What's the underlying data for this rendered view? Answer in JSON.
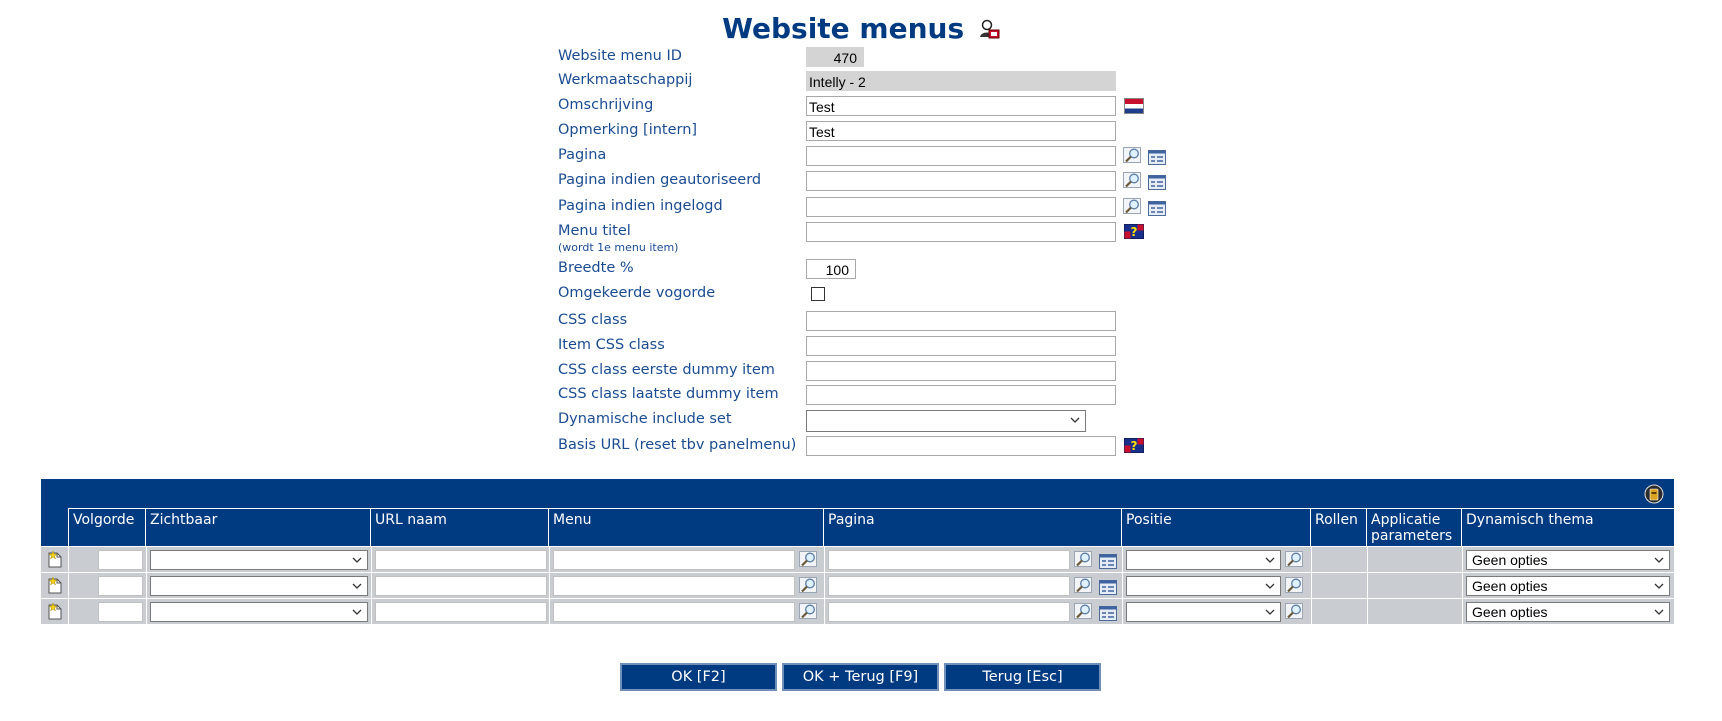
{
  "page": {
    "title": "Website menus"
  },
  "form": {
    "fields": [
      {
        "label": "Website menu ID",
        "value": "470"
      },
      {
        "label": "Werkmaatschappij",
        "value": "Intelly  -  2"
      },
      {
        "label": "Omschrijving",
        "value": "Test"
      },
      {
        "label": "Opmerking [intern]",
        "value": "Test"
      },
      {
        "label": "Pagina",
        "value": ""
      },
      {
        "label": "Pagina indien geautoriseerd",
        "value": ""
      },
      {
        "label": "Pagina indien ingelogd",
        "value": ""
      },
      {
        "label": "Menu titel",
        "sublabel": "(wordt 1e menu item)",
        "value": ""
      },
      {
        "label": "Breedte %",
        "value": "100"
      },
      {
        "label": "Omgekeerde vogorde",
        "checked": false
      },
      {
        "label": "CSS class",
        "value": ""
      },
      {
        "label": "Item CSS class",
        "value": ""
      },
      {
        "label": "CSS class eerste dummy item",
        "value": ""
      },
      {
        "label": "CSS class laatste dummy item",
        "value": ""
      },
      {
        "label": "Dynamische include set",
        "value": ""
      },
      {
        "label": "Basis URL (reset tbv panelmenu)",
        "value": ""
      }
    ]
  },
  "grid": {
    "columns": [
      "Volgorde",
      "Zichtbaar",
      "URL naam",
      "Menu",
      "Pagina",
      "Positie",
      "Rollen",
      "Applicatie parameters",
      "Dynamisch thema"
    ],
    "rows": [
      {
        "thema": "Geen opties"
      },
      {
        "thema": "Geen opties"
      },
      {
        "thema": "Geen opties"
      }
    ]
  },
  "buttons": {
    "ok": "OK [F2]",
    "ok_back": "OK + Terug [F9]",
    "back": "Terug [Esc]"
  },
  "colors": {
    "primary": "#003a80",
    "label": "#1b4c91",
    "readonly": "#d4d4d4",
    "row": "#c9ccd1"
  }
}
